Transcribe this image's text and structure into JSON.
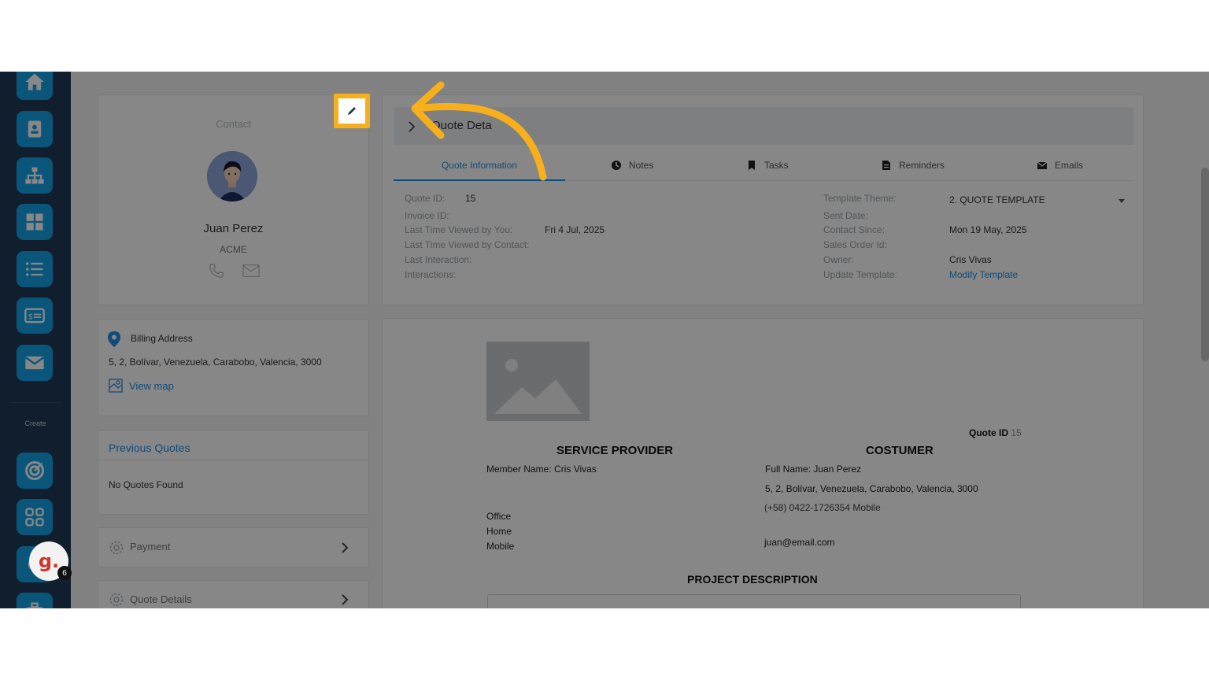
{
  "sidebar": {
    "create_label": "Create",
    "nav_items": [
      {
        "icon": "home-icon"
      },
      {
        "icon": "contact-card-icon"
      },
      {
        "icon": "org-chart-icon"
      },
      {
        "icon": "dashboard-grid-icon"
      },
      {
        "icon": "list-icon"
      },
      {
        "icon": "billing-card-icon"
      },
      {
        "icon": "mail-icon"
      }
    ],
    "create_items": [
      {
        "icon": "target-icon"
      },
      {
        "icon": "apps-grid-icon"
      },
      {
        "icon": "settings-icon"
      },
      {
        "icon": "briefcase-icon"
      }
    ]
  },
  "contact": {
    "heading": "Contact",
    "name": "Juan Perez",
    "company": "ACME",
    "edit_icon": "pencil-icon"
  },
  "billing": {
    "title": "Billing Address",
    "address": "5, 2, Bolívar, Venezuela, Carabobo, Valencia, 3000",
    "view_map": "View map"
  },
  "previous_quotes": {
    "title": "Previous Quotes",
    "empty": "No Quotes Found"
  },
  "accordions": {
    "payment": "Payment",
    "quote_details": "Quote Details"
  },
  "quote_panel": {
    "title": "Quote Deta",
    "tabs": [
      "Quote Information",
      "Notes",
      "Tasks",
      "Reminders",
      "Emails"
    ],
    "left": {
      "quote_id_label": "Quote ID:",
      "quote_id_value": "15",
      "invoice_id_label": "Invoice ID:",
      "viewed_you_label": "Last Time Viewed by You:",
      "viewed_you_value": "Fri 4 Jul, 2025",
      "viewed_contact_label": "Last Time Viewed by Contact:",
      "last_interaction_label": "Last Interaction:",
      "interactions_label": "Interactions:"
    },
    "right": {
      "template_theme_label": "Template Theme:",
      "template_theme_value": "2. QUOTE TEMPLATE",
      "sent_date_label": "Sent Date:",
      "contact_since_label": "Contact Since:",
      "contact_since_value": "Mon 19 May, 2025",
      "sales_order_label": "Sales Order Id:",
      "owner_label": "Owner:",
      "owner_value": "Cris Vivas",
      "update_template_label": "Update Template:",
      "modify_template": "Modify Template"
    }
  },
  "document": {
    "quote_id_label": "Quote ID",
    "quote_id_value": "15",
    "service_provider": "SERVICE PROVIDER",
    "member_name_label": "Member Name:",
    "member_name_value": "Cris Vivas",
    "office": "Office",
    "home": "Home",
    "mobile": "Mobile",
    "customer": "COSTUMER",
    "full_name_label": "Full Name:",
    "full_name_value": "Juan Perez",
    "customer_address": "5, 2, Bolívar, Venezuela, Carabobo, Valencia, 3000",
    "customer_phone": "(+58) 0422-1726354 Mobile",
    "customer_email": "juan@email.com",
    "project_description": "PROJECT DESCRIPTION"
  },
  "widget": {
    "logo_text": "g.",
    "count": "6"
  },
  "colors": {
    "sidebar_bg": "#1f3a57",
    "sidebar_button": "#14a3e6",
    "accent_blue": "#1e90e8",
    "highlight_orange": "#f7b01c",
    "overlay": "rgba(0,0,0,0.47)"
  }
}
